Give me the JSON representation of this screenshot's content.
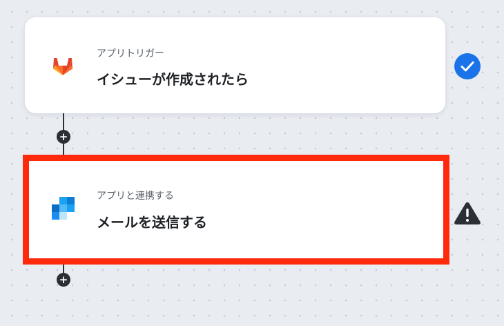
{
  "trigger": {
    "label": "アプリトリガー",
    "title": "イシューが作成されたら",
    "app_icon": "gitlab-icon",
    "status_icon": "check-circle-icon"
  },
  "action": {
    "label": "アプリと連携する",
    "title": "メールを送信する",
    "app_icon": "mail-app-icon",
    "status_icon": "warning-triangle-icon"
  },
  "add_step_label": "+",
  "colors": {
    "highlight_border": "#ff2a0c",
    "check_blue": "#1a73e8",
    "gitlab_orange": "#e24329",
    "canvas_bg": "#e9ecf1"
  }
}
